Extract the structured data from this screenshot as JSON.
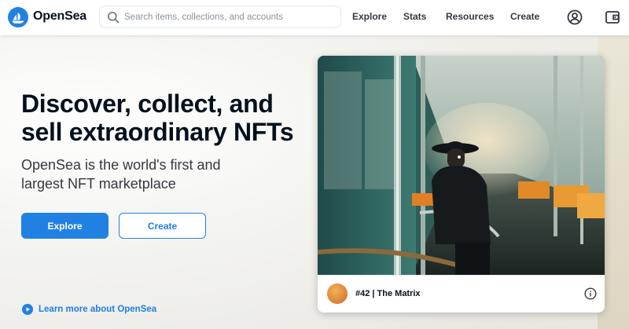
{
  "header": {
    "brand": "OpenSea",
    "search_placeholder": "Search items, collections, and accounts",
    "nav": [
      "Explore",
      "Stats",
      "Resources",
      "Create"
    ],
    "icons": [
      "profile-icon",
      "wallet-icon"
    ]
  },
  "hero": {
    "headline_line1": "Discover, collect, and",
    "headline_line2": "sell extraordinary NFTs",
    "subhead_line1": "OpenSea is the world's first and",
    "subhead_line2": "largest NFT marketplace",
    "primary_button": "Explore",
    "secondary_button": "Create",
    "learn_more": "Learn more about OpenSea"
  },
  "featured": {
    "title": "#42 | The Matrix",
    "icons": [
      "creator-avatar",
      "info-icon"
    ]
  },
  "colors": {
    "accent": "#2081e2",
    "text_primary": "#04111d",
    "text_secondary": "#353840"
  }
}
